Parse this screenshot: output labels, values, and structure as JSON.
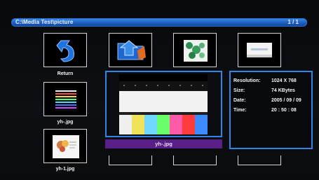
{
  "header": {
    "path": "C:\\Media  Test\\picture",
    "page": "1 / 1"
  },
  "thumbs": [
    {
      "label": "Return"
    },
    {
      "label": ""
    },
    {
      "label": ""
    },
    {
      "label": ""
    },
    {
      "label": "yh-.jpg"
    },
    {
      "label": "yh-1.jpg"
    }
  ],
  "preview": {
    "filename": "yh-.jpg"
  },
  "info": {
    "resolution_label": "Resolution:",
    "resolution_value": "1024 X 768",
    "size_label": "Size:",
    "size_value": "74 KBytes",
    "date_label": "Date:",
    "date_value": "2005 / 09 / 09",
    "time_label": "Time:",
    "time_value": "20 : 50 : 08"
  },
  "colors": {
    "accent": "#2f86e8",
    "filename_bar": "#5a1f86"
  }
}
